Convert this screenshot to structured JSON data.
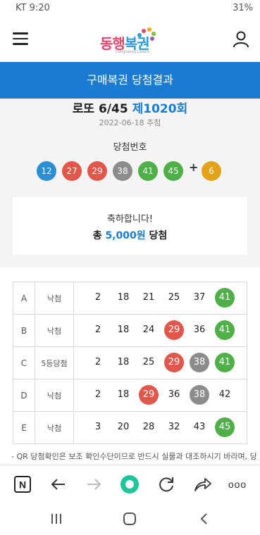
{
  "status": {
    "carrier_time": "KT 9:20",
    "battery": "31%"
  },
  "header": {
    "logo_text_1": "동행",
    "logo_text_2": "복권",
    "logo_sub": "Donghaeng Lottery"
  },
  "page_title": "구매복권 당첨결과",
  "draw": {
    "game": "로또 6/45",
    "round": "제1020회",
    "date": "2022-06-18 추첨",
    "winning_label": "당첨번호"
  },
  "winning_numbers": [
    {
      "n": "12",
      "color": "#2b8fd6"
    },
    {
      "n": "27",
      "color": "#e2574c"
    },
    {
      "n": "29",
      "color": "#e2574c"
    },
    {
      "n": "38",
      "color": "#8c8c8c"
    },
    {
      "n": "41",
      "color": "#4fb048"
    },
    {
      "n": "45",
      "color": "#4fb048"
    }
  ],
  "plus_sign": "+",
  "bonus_number": {
    "n": "6",
    "color": "#e3a21a"
  },
  "prize": {
    "congrats": "축하합니다!",
    "prefix": "총",
    "amount": "5,000원",
    "suffix": "당첨"
  },
  "tickets": [
    {
      "letter": "A",
      "result": "낙첨",
      "numbers": [
        {
          "n": "2"
        },
        {
          "n": "18"
        },
        {
          "n": "21"
        },
        {
          "n": "25"
        },
        {
          "n": "37"
        },
        {
          "n": "41",
          "color": "#4fb048"
        }
      ]
    },
    {
      "letter": "B",
      "result": "낙첨",
      "numbers": [
        {
          "n": "2"
        },
        {
          "n": "18"
        },
        {
          "n": "24"
        },
        {
          "n": "29",
          "color": "#e2574c"
        },
        {
          "n": "36"
        },
        {
          "n": "41",
          "color": "#4fb048"
        }
      ]
    },
    {
      "letter": "C",
      "result": "5등당첨",
      "numbers": [
        {
          "n": "2"
        },
        {
          "n": "18"
        },
        {
          "n": "25"
        },
        {
          "n": "29",
          "color": "#e2574c"
        },
        {
          "n": "38",
          "color": "#8c8c8c"
        },
        {
          "n": "41",
          "color": "#4fb048"
        }
      ]
    },
    {
      "letter": "D",
      "result": "낙첨",
      "numbers": [
        {
          "n": "2"
        },
        {
          "n": "18"
        },
        {
          "n": "29",
          "color": "#e2574c"
        },
        {
          "n": "36"
        },
        {
          "n": "38",
          "color": "#8c8c8c"
        },
        {
          "n": "42"
        }
      ]
    },
    {
      "letter": "E",
      "result": "낙첨",
      "numbers": [
        {
          "n": "3"
        },
        {
          "n": "20"
        },
        {
          "n": "28"
        },
        {
          "n": "32"
        },
        {
          "n": "43"
        },
        {
          "n": "45",
          "color": "#4fb048"
        }
      ]
    }
  ],
  "note": "- QR 당첨확인은 보조 확인수단이므로 반드시 실물과 대조하시기 바라며, 당",
  "toolbar": {
    "n_label": "N",
    "more_label": "ooo"
  }
}
